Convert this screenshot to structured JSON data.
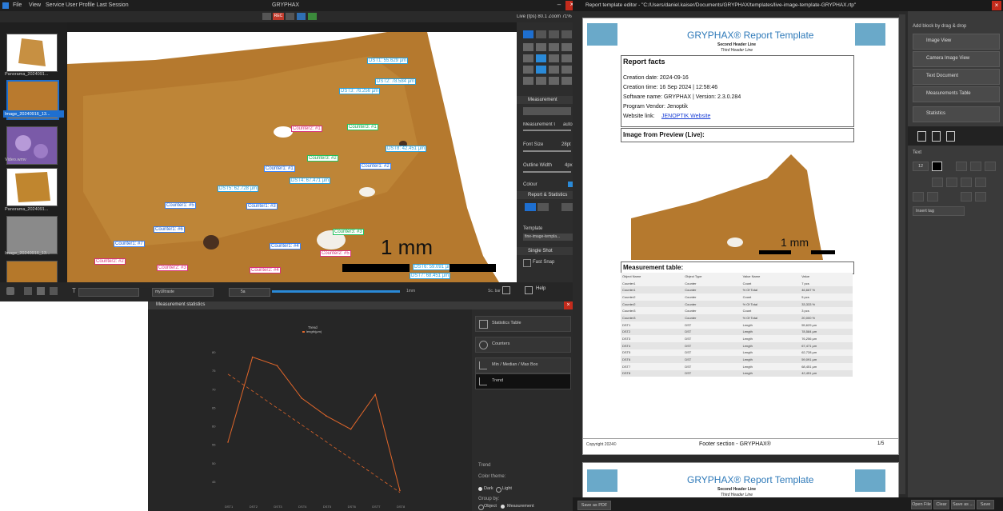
{
  "main": {
    "menu": [
      "File",
      "View",
      "Service",
      "User Profile Last Session"
    ],
    "app_title": "GRYPHAX",
    "rec_label": "REC",
    "live_status": "Live (fps) 80.1   Zoom 71%",
    "thumbnails": [
      "Panorama_2024091...",
      "Image_20240916_13...",
      "Video.wmv",
      "Panorama_2024091...",
      "Image_20240916_13...",
      ""
    ],
    "counters": [
      "Counter2: #1",
      "Counter3: #1",
      "Counter3: #2",
      "Counter1: #1",
      "Counter1: #2",
      "Counter1: #5",
      "Counter1: #3",
      "Counter3: #3",
      "Counter1: #6",
      "Counter1: #7",
      "Counter1: #4",
      "Counter2: #5",
      "Counter2: #2",
      "Counter2: #3",
      "Counter2: #4"
    ],
    "distances": [
      "DST1: 55.629 µm",
      "DST2: 78.584 µm",
      "DST3: 76.256 µm",
      "DST8: 42.451 µm",
      "DST4: 67.471 µm",
      "DST5: 62.728 µm",
      "DST6: 59.091 µm",
      "DST7: 68.451 µm"
    ],
    "scale_label": "1 mm",
    "panel": {
      "measurement_heading": "Measurement",
      "unit_label": "Measurement Un...",
      "unit_value": "auto",
      "font_size_label": "Font Size",
      "font_size_value": "28pt",
      "outline_label": "Outline Width",
      "outline_value": "4px",
      "colour_label": "Colour",
      "report_heading": "Report & Statistics",
      "template_label": "Template",
      "template_value": "fine-image-templa...",
      "single_shot_heading": "Single Shot",
      "fast_snap_label": "Fast Snap",
      "help_label": "Help"
    },
    "bottom": {
      "text_label": "T",
      "style_value": "myUltraste",
      "color_value": "5a",
      "scale_value": "1mm",
      "scalebar_label": "Sc. bar"
    }
  },
  "stats": {
    "title": "Measurement statistics",
    "buttons": [
      "Statistics Table",
      "Counters",
      "Min / Median / Max Box",
      "Trend"
    ],
    "selected_button": "Trend",
    "trend_heading": "Trend",
    "color_theme_label": "Color theme:",
    "theme_options": [
      "Dark",
      "Light"
    ],
    "group_by_label": "Group by:",
    "group_options": [
      "Object",
      "Measurement"
    ]
  },
  "chart_data": {
    "type": "line",
    "title": "Trend",
    "legend": "length(µm)",
    "x": [
      "DST1",
      "DST2",
      "DST3",
      "DST4",
      "DST5",
      "DST6",
      "DST7",
      "DST8"
    ],
    "series": [
      {
        "name": "length(µm)",
        "values": [
          55.6,
          78.6,
          76.3,
          67.5,
          62.7,
          59.1,
          68.5,
          42.5
        ]
      }
    ],
    "trend_values": [
      74.0,
      42.0
    ],
    "ylim": [
      40,
      85
    ],
    "yticks": [
      45,
      50,
      55,
      60,
      65,
      70,
      75,
      80
    ],
    "color": "#e0662a"
  },
  "report": {
    "title": "Report template editor - \"C:/Users/daniel.kaiser/Documents/GRYPHAX/templates/live-image-template-GRYPHAX.rtp\"",
    "page_title": "GRYPHAX® Report Template",
    "second_header": "Second Header Line",
    "third_header": "Third Header Line",
    "facts_heading": "Report facts",
    "facts": [
      "Creation date: 2024-09-16",
      "Creation time: 16 Sep 2024  |  12:58:46",
      "Software name: GRYPHAX | Version: 2.3.0.284",
      "Program Vendor: Jenoptik"
    ],
    "website_label": "Website link: ",
    "website_link": "JENOPTIK Website",
    "image_heading": "Image from Preview (Live):",
    "scale_label": "1 mm",
    "table_heading": "Measurement table:",
    "table_headers": [
      "Object Name",
      "Object Type",
      "Value Name",
      "Value"
    ],
    "table_rows": [
      [
        "Counter1",
        "Counter",
        "Count",
        "7 pcs"
      ],
      [
        "Counter1",
        "Counter",
        "% Of Total",
        "46,667 %"
      ],
      [
        "Counter2",
        "Counter",
        "Count",
        "5 pcs"
      ],
      [
        "Counter2",
        "Counter",
        "% Of Total",
        "33,333 %"
      ],
      [
        "Counter3",
        "Counter",
        "Count",
        "3 pcs"
      ],
      [
        "Counter3",
        "Counter",
        "% Of Total",
        "20,000 %"
      ],
      [
        "DST1",
        "DST",
        "Length",
        "55,629 µm"
      ],
      [
        "DST2",
        "DST",
        "Length",
        "78,584 µm"
      ],
      [
        "DST3",
        "DST",
        "Length",
        "76,256 µm"
      ],
      [
        "DST4",
        "DST",
        "Length",
        "67,471 µm"
      ],
      [
        "DST5",
        "DST",
        "Length",
        "62,728 µm"
      ],
      [
        "DST6",
        "DST",
        "Length",
        "59,091 µm"
      ],
      [
        "DST7",
        "DST",
        "Length",
        "68,451 µm"
      ],
      [
        "DST8",
        "DST",
        "Length",
        "42,451 µm"
      ]
    ],
    "footer_left": "Copyright 2024©",
    "footer_center": "Footer section - GRYPHAX®",
    "footer_right": "1/5",
    "side_heading": "Add block by drag & drop",
    "blocks": [
      "Image View",
      "Camera Image View",
      "Text Document",
      "Measurements Table",
      "Statistics"
    ],
    "text_heading": "Text",
    "font_size_value": "12",
    "insert_tag": "Insert tag",
    "bottom_left": "Save as PDF",
    "bottom_buttons": [
      "Open File",
      "Clear",
      "Save as ...",
      "Save"
    ]
  }
}
